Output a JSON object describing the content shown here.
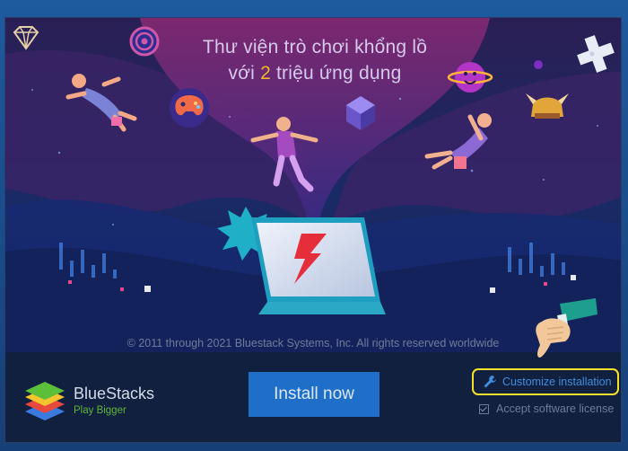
{
  "hero": {
    "headline_line1": "Thư viện trò chơi khổng lồ",
    "headline_line2_prefix": "với ",
    "headline_line2_number": "2",
    "headline_line2_suffix": " triệu ứng dụng",
    "copyright": "© 2011 through 2021 Bluestack Systems, Inc. All rights reserved worldwide"
  },
  "brand": {
    "name": "BlueStacks",
    "tagline": "Play Bigger"
  },
  "actions": {
    "install_label": "Install now",
    "customize_label": "Customize installation",
    "accept_label": "Accept software license",
    "accept_checked": true
  },
  "colors": {
    "install_button": "#1f6fc9",
    "highlight_border": "#f5e12a",
    "accent_text": "#f3b52a",
    "link": "#3f8ee0"
  },
  "icons": [
    "diamond-icon",
    "target-icon",
    "gamepad-icon",
    "smiley-planet-icon",
    "cube-icon",
    "dpad-icon",
    "horn-helmet-icon",
    "wrench-icon",
    "checkbox-icon",
    "pointing-hand-icon"
  ]
}
